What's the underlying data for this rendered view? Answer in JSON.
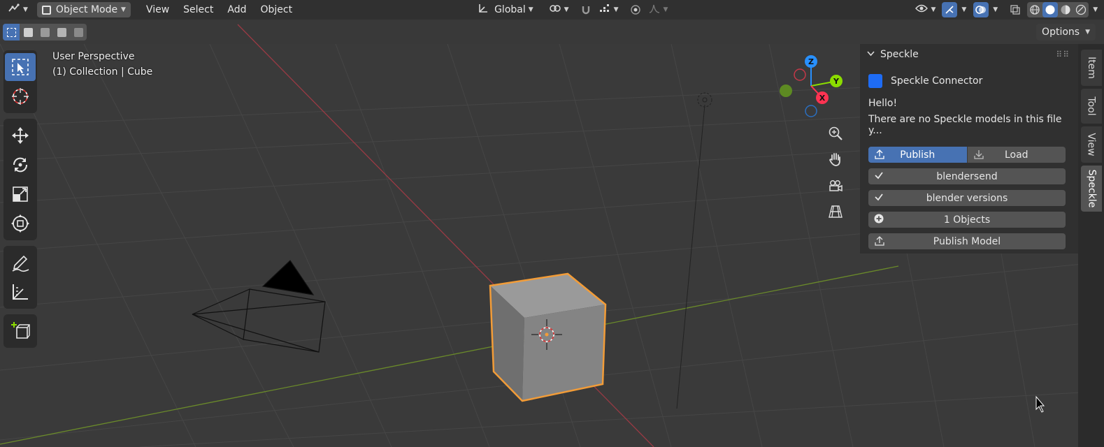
{
  "header": {
    "editor_icon": "editor-type-icon",
    "mode_label": "Object Mode",
    "menus": [
      "View",
      "Select",
      "Add",
      "Object"
    ],
    "orientation_label": "Global"
  },
  "subbar": {
    "options_label": "Options"
  },
  "viewport": {
    "perspective_label": "User Perspective",
    "collection_label": "(1) Collection | Cube",
    "gizmo": {
      "x": "X",
      "y": "Y",
      "z": "Z"
    }
  },
  "panel": {
    "title": "Speckle",
    "connector_label": "Speckle Connector",
    "hello_text": "Hello!",
    "info_text": "There are no Speckle models in this file y...",
    "publish_label": "Publish",
    "load_label": "Load",
    "project_label": "blendersend",
    "model_label": "blender versions",
    "objects_label": "1 Objects",
    "publish_model_label": "Publish Model"
  },
  "tabs": [
    "Item",
    "Tool",
    "View",
    "Speckle"
  ],
  "colors": {
    "accent": "#4772b3",
    "selection_outline": "#f29c38",
    "x_axis": "#ff3352",
    "y_axis": "#8bdc00",
    "z_axis": "#2890ff"
  }
}
